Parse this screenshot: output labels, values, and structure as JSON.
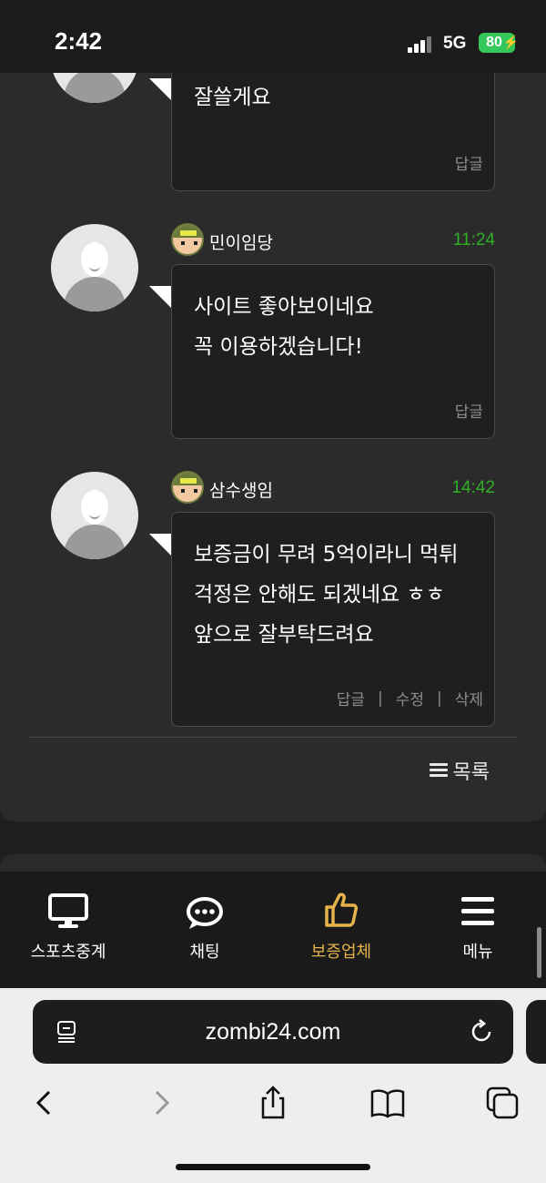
{
  "status": {
    "time": "2:42",
    "network": "5G",
    "battery": "80"
  },
  "comments": [
    {
      "author": "",
      "time": "",
      "lines": [
        "잘쓸게요"
      ],
      "actions": [
        "답글"
      ]
    },
    {
      "author": "민이임당",
      "time": "11:24",
      "lines": [
        "사이트 좋아보이네요",
        "꼭 이용하겠습니다!"
      ],
      "actions": [
        "답글"
      ]
    },
    {
      "author": "삼수생임",
      "time": "14:42",
      "lines": [
        "보증금이 무려 5억이라니 먹튀",
        "걱정은 안해도 되겠네요 ㅎㅎ",
        "앞으로 잘부탁드려요"
      ],
      "actions": [
        "답글",
        "수정",
        "삭제"
      ]
    }
  ],
  "list_button": "목록",
  "nav": [
    {
      "label": "스포츠중계",
      "icon": "monitor-icon"
    },
    {
      "label": "채팅",
      "icon": "chat-bubble-icon"
    },
    {
      "label": "보증업체",
      "icon": "thumbs-up-icon"
    },
    {
      "label": "메뉴",
      "icon": "hamburger-menu-icon"
    }
  ],
  "colors": {
    "accent": "#e6b24a",
    "time_green": "#2fb024"
  },
  "browser": {
    "url": "zombi24.com"
  }
}
